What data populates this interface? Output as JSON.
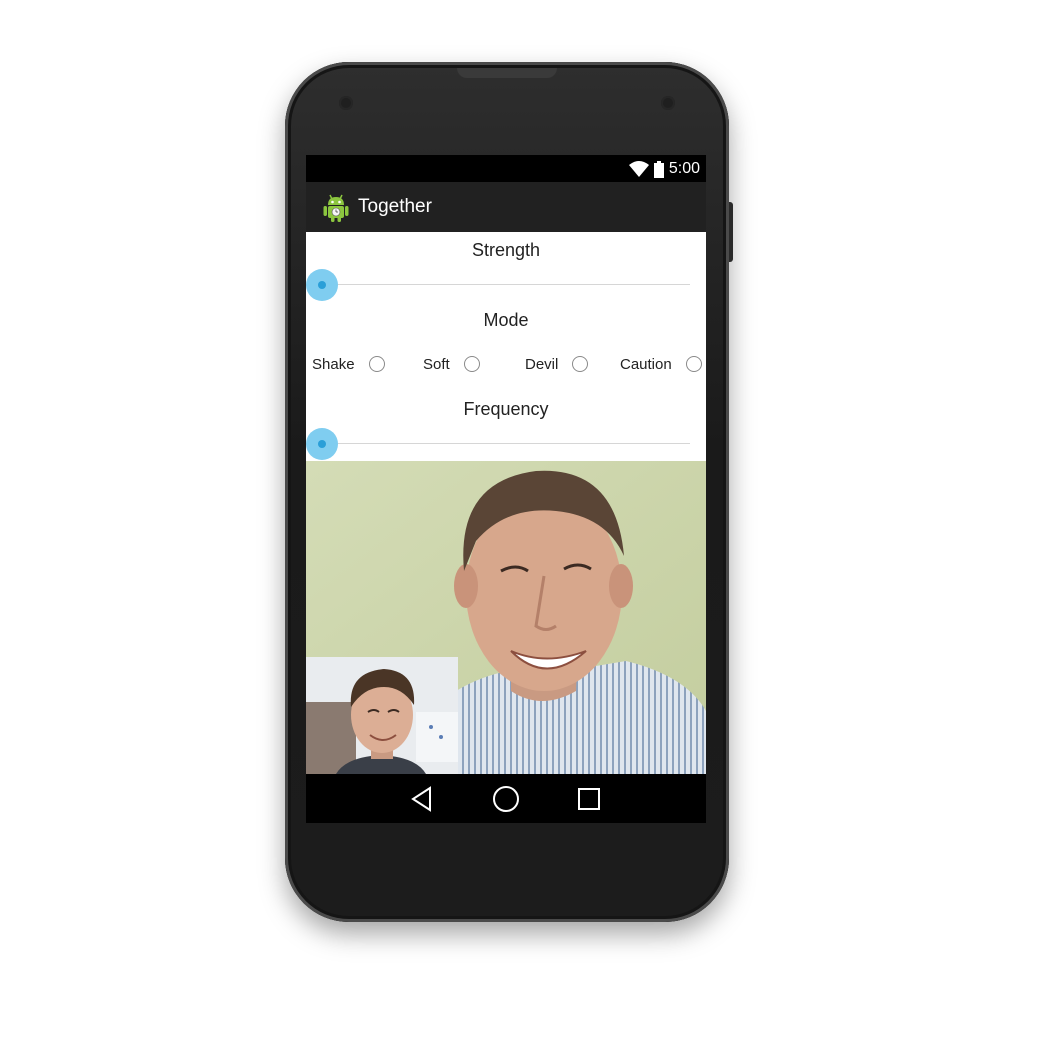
{
  "status_bar": {
    "time": "5:00",
    "icons": [
      "wifi-icon",
      "battery-icon"
    ]
  },
  "action_bar": {
    "title": "Together",
    "icon": "android-icon"
  },
  "controls": {
    "strength_label": "Strength",
    "strength_value": 0,
    "mode_label": "Mode",
    "modes": [
      {
        "label": "Shake",
        "checked": false
      },
      {
        "label": "Soft",
        "checked": false
      },
      {
        "label": "Devil",
        "checked": false
      },
      {
        "label": "Caution",
        "checked": false
      }
    ],
    "frequency_label": "Frequency",
    "frequency_value": 0
  },
  "video": {
    "remote": "remote-video-feed",
    "local": "local-video-preview"
  },
  "nav_bar": {
    "buttons": [
      "back-icon",
      "home-icon",
      "recents-icon"
    ]
  },
  "colors": {
    "slider_accent": "#7fcdf0",
    "slider_dot": "#2a9fd8",
    "action_bar": "#212121",
    "status_bar": "#000000"
  }
}
